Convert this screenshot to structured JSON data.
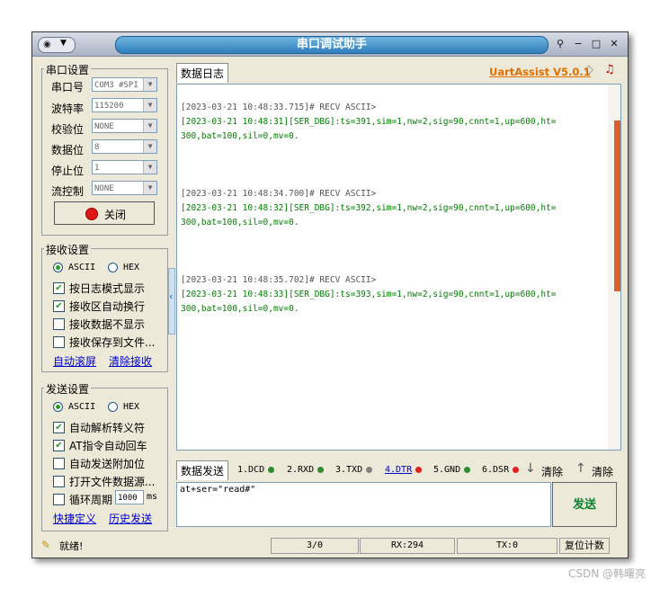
{
  "window": {
    "title": "串口调试助手",
    "brand": "UartAssist V5.0.1"
  },
  "serial_settings": {
    "title": "串口设置",
    "fields": [
      {
        "label": "串口号",
        "value": "COM3 #SPI"
      },
      {
        "label": "波特率",
        "value": "115200"
      },
      {
        "label": "校验位",
        "value": "NONE"
      },
      {
        "label": "数据位",
        "value": "8"
      },
      {
        "label": "停止位",
        "value": "1"
      },
      {
        "label": "流控制",
        "value": "NONE"
      }
    ],
    "close_button": "关闭"
  },
  "receive_settings": {
    "title": "接收设置",
    "radio_ascii": "ASCII",
    "radio_hex": "HEX",
    "options": [
      "按日志模式显示",
      "接收区自动换行",
      "接收数据不显示",
      "接收保存到文件..."
    ],
    "auto_scroll": "自动滚屏",
    "clear_receive": "清除接收"
  },
  "send_settings": {
    "title": "发送设置",
    "radio_ascii": "ASCII",
    "radio_hex": "HEX",
    "options": [
      "自动解析转义符",
      "AT指令自动回车",
      "自动发送附加位",
      "打开文件数据源..."
    ],
    "cycle_label": "循环周期",
    "cycle_value": "1000",
    "cycle_unit": "ms",
    "quick_def": "快捷定义",
    "history": "历史发送"
  },
  "log": {
    "tab": "数据日志",
    "entries": [
      {
        "header": "[2023-03-21 10:48:33.715]# RECV ASCII>",
        "line1": "[2023-03-21 10:48:31][SER_DBG]:ts=391,sim=1,nw=2,sig=90,cnnt=1,up=600,ht=",
        "line2": "300,bat=100,sil=0,mv=0."
      },
      {
        "header": "[2023-03-21 10:48:34.700]# RECV ASCII>",
        "line1": "[2023-03-21 10:48:32][SER_DBG]:ts=392,sim=1,nw=2,sig=90,cnnt=1,up=600,ht=",
        "line2": "300,bat=100,sil=0,mv=0."
      },
      {
        "header": "[2023-03-21 10:48:35.702]# RECV ASCII>",
        "line1": "[2023-03-21 10:48:33][SER_DBG]:ts=393,sim=1,nw=2,sig=90,cnnt=1,up=600,ht=",
        "line2": "300,bat=100,sil=0,mv=0."
      }
    ]
  },
  "send": {
    "tab": "数据发送",
    "lines": [
      {
        "label": "1.DCD",
        "color": "#2e8b2e"
      },
      {
        "label": "2.RXD",
        "color": "#2e8b2e"
      },
      {
        "label": "3.TXD",
        "color": "#808080"
      },
      {
        "label": "4.DTR",
        "color": "#e02020"
      },
      {
        "label": "5.GND",
        "color": "#2e8b2e"
      },
      {
        "label": "6.DSR",
        "color": "#e02020"
      }
    ],
    "clear1": "清除",
    "clear2": "清除",
    "input": "at+ser=\"read#\"",
    "button": "发送"
  },
  "status": {
    "ready": "就绪!",
    "count": "3/0",
    "rx": "RX:294",
    "tx": "TX:0",
    "reset": "复位计数"
  },
  "watermark": "CSDN @韩曙亮"
}
